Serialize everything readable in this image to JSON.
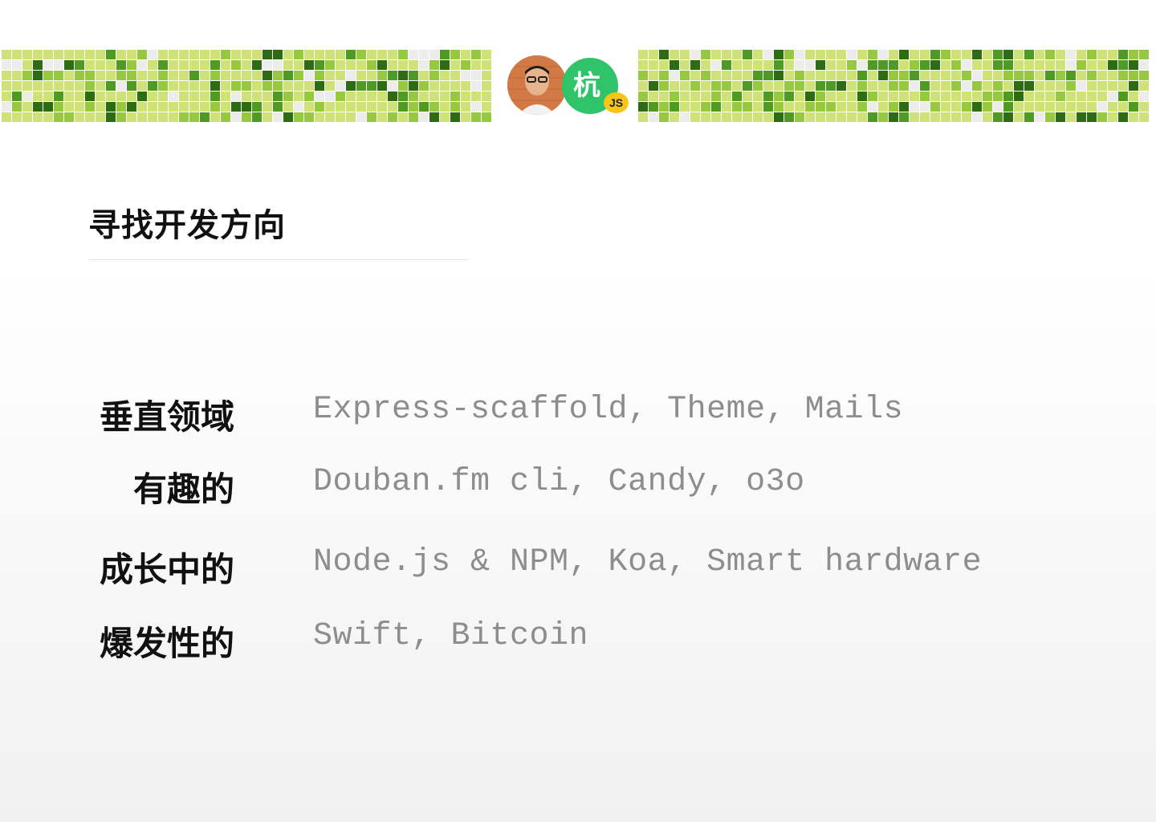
{
  "header": {
    "brand_badge_text": "杭",
    "brand_badge_sub": "JS",
    "avatar": "speaker-avatar",
    "colors": {
      "badge_green": "#2fc46a",
      "badge_yellow": "#f5c518",
      "activity_light": "#cfe27a",
      "activity_mid": "#97c940",
      "activity_dark": "#4e9a24",
      "activity_darkest": "#2e6b15",
      "activity_empty": "#ececec"
    }
  },
  "slide": {
    "title": "寻找开发方向",
    "rows": [
      {
        "label": "垂直领域",
        "value": "Express-scaffold, Theme, Mails"
      },
      {
        "label": "有趣的",
        "value": "Douban.fm cli, Candy, o3o"
      },
      {
        "label": "成长中的",
        "value": "Node.js & NPM, Koa, Smart hardware"
      },
      {
        "label": "爆发性的",
        "value": "Swift, Bitcoin"
      }
    ]
  }
}
